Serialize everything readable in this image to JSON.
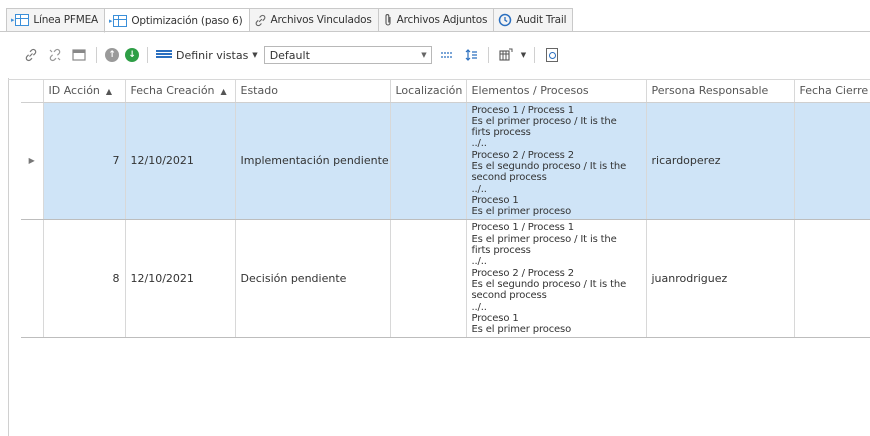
{
  "tabs": [
    {
      "label": "Línea PFMEA",
      "icon": "grid-icon"
    },
    {
      "label": "Optimización (paso 6)",
      "icon": "grid-icon",
      "active": true
    },
    {
      "label": "Archivos Vinculados",
      "icon": "link-icon"
    },
    {
      "label": "Archivos Adjuntos",
      "icon": "paperclip-icon"
    },
    {
      "label": "Audit Trail",
      "icon": "history-icon"
    }
  ],
  "toolbar": {
    "views_label": "Definir vistas",
    "views_select_value": "Default"
  },
  "grid": {
    "columns": [
      "ID Acción",
      "Fecha Creación",
      "Estado",
      "Localización",
      "Elementos / Procesos",
      "Persona Responsable",
      "Fecha Cierre"
    ],
    "rows": [
      {
        "id": "7",
        "fecha": "12/10/2021",
        "estado": "Implementación pendiente",
        "localizacion": "",
        "elementos": [
          "Proceso 1 / Process 1",
          "Es el primer proceso / It is the",
          "firts process",
          "../..",
          "Proceso 2 / Process 2",
          "Es el segundo proceso / It is the",
          "second process",
          "../..",
          "Proceso 1",
          "Es el primer proceso"
        ],
        "persona": "ricardoperez",
        "fecha_cierre": ""
      },
      {
        "id": "8",
        "fecha": "12/10/2021",
        "estado": "Decisión pendiente",
        "localizacion": "",
        "elementos": [
          "Proceso 1 / Process 1",
          "Es el primer proceso / It is the",
          "firts process",
          "../..",
          "Proceso 2 / Process 2",
          "Es el segundo proceso / It is the",
          "second process",
          "../..",
          "Proceso 1",
          "Es el primer proceso"
        ],
        "persona": "juanrodriguez",
        "fecha_cierre": ""
      }
    ]
  },
  "colors": {
    "selected_row": "#cfe4f7",
    "accent_blue": "#2b6fbf",
    "green": "#2e9e46"
  }
}
